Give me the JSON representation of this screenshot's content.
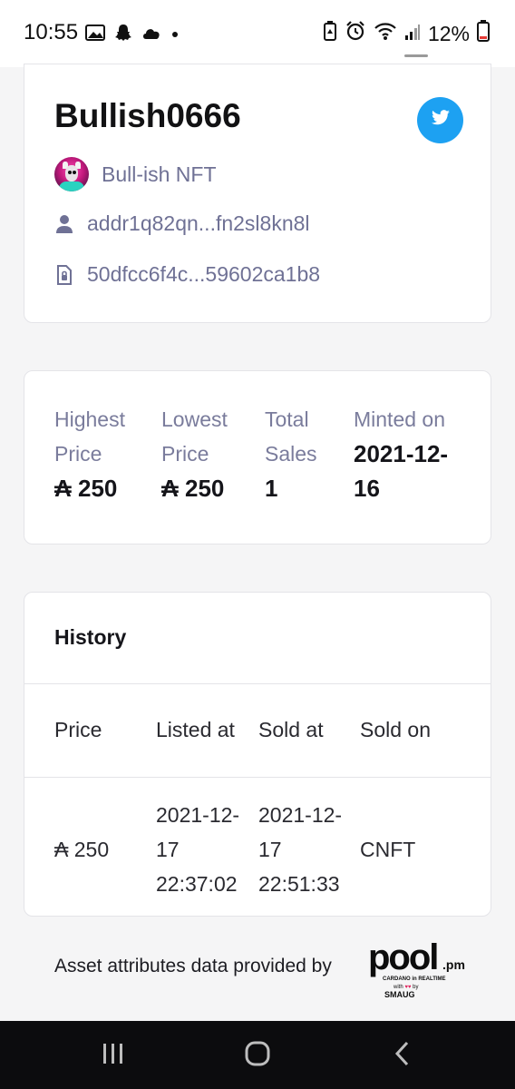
{
  "status_bar": {
    "time": "10:55",
    "battery": "12%"
  },
  "nft": {
    "title": "Bullish0666",
    "collection": "Bull-ish NFT",
    "owner_address": "addr1q82qn...fn2sl8kn8l",
    "policy_id": "50dfcc6f4c...59602ca1b8"
  },
  "stats": {
    "highest_label": "Highest Price",
    "highest_value": "₳ 250",
    "lowest_label": "Lowest Price",
    "lowest_value": "₳ 250",
    "total_label": "Total Sales",
    "total_value": "1",
    "minted_label": "Minted on",
    "minted_value": "2021-12-16"
  },
  "history": {
    "title": "History",
    "columns": [
      "Price",
      "Listed at",
      "Sold at",
      "Sold on"
    ],
    "rows": [
      {
        "price": "₳ 250",
        "listed_at": "2021-12-17 22:37:02",
        "sold_at": "2021-12-17 22:51:33",
        "sold_on": "CNFT"
      }
    ]
  },
  "footer": {
    "attribution": "Asset attributes data provided by",
    "logo_text": "pool.pm",
    "logo_tagline": "CARDANO in REALTIME",
    "logo_credit": "with ♥♥ by SMAUG"
  },
  "colors": {
    "twitter": "#1da1f2",
    "muted_text": "#6f7195"
  },
  "icons": [
    "picture-icon",
    "snapchat-icon",
    "cloud-icon",
    "dot-icon",
    "battery-saver-icon",
    "alarm-icon",
    "wifi-icon",
    "signal-icon",
    "battery-icon",
    "twitter-icon",
    "user-icon",
    "policy-file-icon",
    "recents-icon",
    "home-icon",
    "back-icon"
  ]
}
